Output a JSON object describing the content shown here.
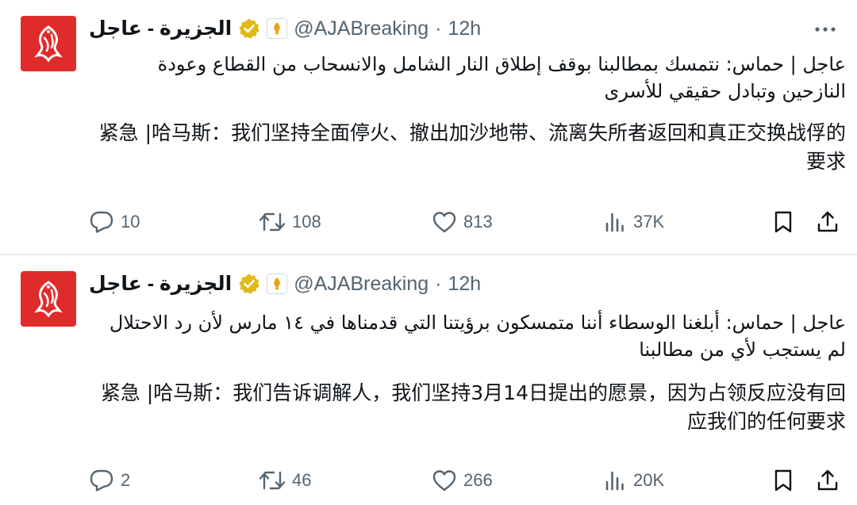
{
  "tweets": [
    {
      "author": {
        "name": "الجزيرة - عاجل",
        "handle": "@AJABreaking",
        "time_separator": "·",
        "time": "12h"
      },
      "body_arabic": "عاجل | حماس: نتمسك بمطالبنا بوقف إطلاق النار الشامل والانسحاب من القطاع وعودة النازحين وتبادل حقيقي للأسرى",
      "body_chinese": "紧急 |哈马斯：我们坚持全面停火、撤出加沙地带、流离失所者返回和真正交换战俘的要求",
      "stats": {
        "replies": "10",
        "reposts": "108",
        "likes": "813",
        "views": "37K"
      }
    },
    {
      "author": {
        "name": "الجزيرة - عاجل",
        "handle": "@AJABreaking",
        "time_separator": "·",
        "time": "12h"
      },
      "body_arabic": "عاجل | حماس: أبلغنا الوسطاء أننا متمسكون برؤيتنا التي قدمناها في ١٤ مارس لأن رد الاحتلال لم يستجب لأي من مطالبنا",
      "body_chinese": "紧急 |哈马斯：我们告诉调解人，我们坚持3月14日提出的愿景，因为占领反应没有回应我们的任何要求",
      "stats": {
        "replies": "2",
        "reposts": "46",
        "likes": "266",
        "views": "20K"
      }
    }
  ],
  "icons": {
    "avatar": "al-jazeera-logo-icon",
    "verified": "gold-verified-badge-icon",
    "affiliate": "affiliate-badge-icon",
    "more": "more-options-icon",
    "reply": "reply-icon",
    "repost": "repost-icon",
    "like": "heart-icon",
    "views": "views-icon",
    "bookmark": "bookmark-icon",
    "share": "share-icon"
  },
  "colors": {
    "text_primary": "#0f1419",
    "text_secondary": "#536471",
    "verified_gold": "#e2b719",
    "avatar_red": "#e02b2b",
    "divider": "#e6e9ec"
  }
}
